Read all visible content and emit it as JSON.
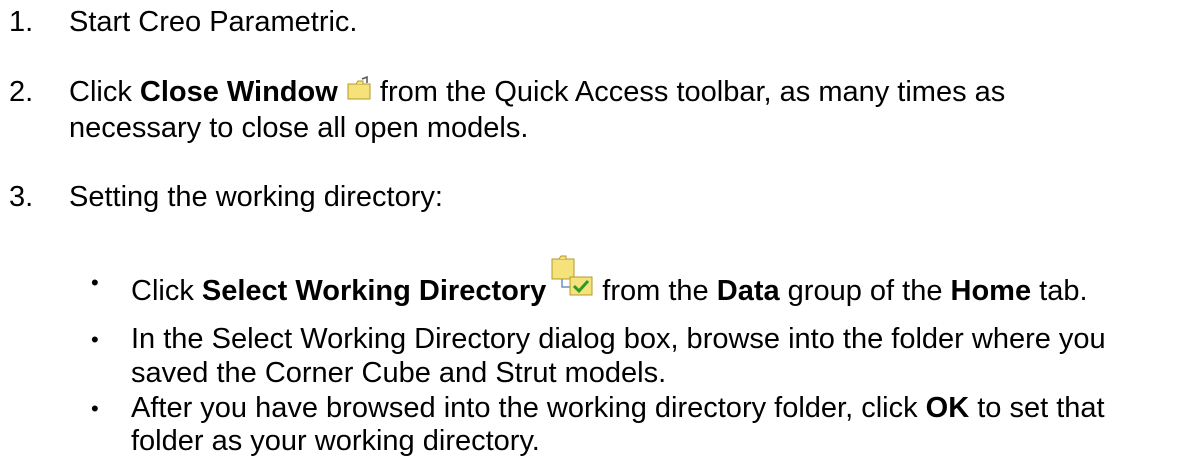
{
  "steps": [
    {
      "num": "1.",
      "text": "Start Creo Parametric."
    },
    {
      "num": "2.",
      "pre": "Click ",
      "bold": "Close Window",
      "post": " from the Quick Access toolbar, as many times as",
      "line2": "necessary to close all open models.",
      "icon": "close-window-icon"
    },
    {
      "num": "3.",
      "text": "Setting the working directory:"
    }
  ],
  "bullets": [
    {
      "b1_pre": "Click ",
      "b1_bold1": "Select Working Directory",
      "b1_mid": " from the ",
      "b1_bold2": "Data",
      "b1_mid2": " group of the ",
      "b1_bold3": "Home",
      "b1_post": " tab.",
      "icon": "select-working-directory-icon"
    },
    {
      "line1": "In the Select Working Directory dialog box, browse into the folder where you",
      "line2": "saved the Corner Cube and Strut models."
    },
    {
      "line1_pre": "After you have browsed into the working directory folder, click ",
      "line1_bold": "OK",
      "line1_post": " to set that",
      "line2": "folder as your working directory."
    }
  ],
  "bullet_char": "•",
  "colors": {
    "folder_yellow": "#f6e27a",
    "folder_edge": "#b39a2c",
    "check_green": "#2a9a2a"
  }
}
